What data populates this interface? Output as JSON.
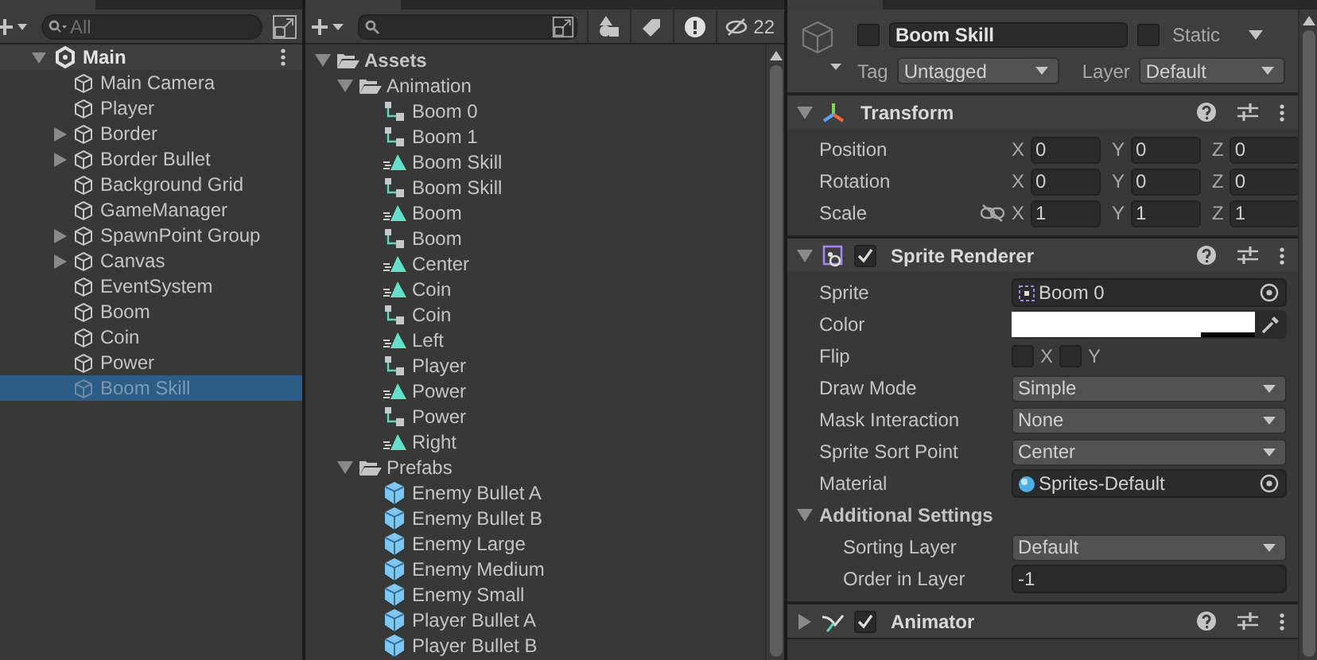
{
  "hierarchy": {
    "search": {
      "placeholder": "All"
    },
    "scene": "Main",
    "items": [
      {
        "name": "Main Camera",
        "kind": "object",
        "selected": false
      },
      {
        "name": "Player",
        "kind": "object",
        "selected": false
      },
      {
        "name": "Border",
        "kind": "group",
        "selected": false
      },
      {
        "name": "Border Bullet",
        "kind": "group",
        "selected": false
      },
      {
        "name": "Background Grid",
        "kind": "object",
        "selected": false
      },
      {
        "name": "GameManager",
        "kind": "object",
        "selected": false
      },
      {
        "name": "SpawnPoint Group",
        "kind": "group",
        "selected": false
      },
      {
        "name": "Canvas",
        "kind": "group",
        "selected": false
      },
      {
        "name": "EventSystem",
        "kind": "object",
        "selected": false
      },
      {
        "name": "Boom",
        "kind": "object",
        "selected": false
      },
      {
        "name": "Coin",
        "kind": "object",
        "selected": false
      },
      {
        "name": "Power",
        "kind": "object",
        "selected": false
      },
      {
        "name": "Boom Skill",
        "kind": "object",
        "selected": true
      }
    ]
  },
  "project": {
    "hidden_count": "22",
    "tree": [
      {
        "name": "Assets",
        "kind": "folder",
        "expanded": true,
        "children": [
          {
            "name": "Animation",
            "kind": "folder",
            "expanded": true,
            "children": [
              {
                "name": "Boom 0",
                "kind": "controller"
              },
              {
                "name": "Boom 1",
                "kind": "controller"
              },
              {
                "name": "Boom Skill",
                "kind": "clip"
              },
              {
                "name": "Boom Skill",
                "kind": "controller"
              },
              {
                "name": "Boom",
                "kind": "clip"
              },
              {
                "name": "Boom",
                "kind": "controller"
              },
              {
                "name": "Center",
                "kind": "clip"
              },
              {
                "name": "Coin",
                "kind": "clip"
              },
              {
                "name": "Coin",
                "kind": "controller"
              },
              {
                "name": "Left",
                "kind": "clip"
              },
              {
                "name": "Player",
                "kind": "controller"
              },
              {
                "name": "Power",
                "kind": "clip"
              },
              {
                "name": "Power",
                "kind": "controller"
              },
              {
                "name": "Right",
                "kind": "clip"
              }
            ]
          },
          {
            "name": "Prefabs",
            "kind": "folder",
            "expanded": true,
            "children": [
              {
                "name": "Enemy Bullet A",
                "kind": "prefab"
              },
              {
                "name": "Enemy Bullet B",
                "kind": "prefab"
              },
              {
                "name": "Enemy Large",
                "kind": "prefab"
              },
              {
                "name": "Enemy Medium",
                "kind": "prefab"
              },
              {
                "name": "Enemy Small",
                "kind": "prefab"
              },
              {
                "name": "Player Bullet A",
                "kind": "prefab"
              },
              {
                "name": "Player Bullet B",
                "kind": "prefab"
              }
            ]
          }
        ]
      }
    ]
  },
  "inspector": {
    "object_name": "Boom Skill",
    "active": false,
    "static": false,
    "static_label": "Static",
    "tag_label": "Tag",
    "tag": "Untagged",
    "layer_label": "Layer",
    "layer": "Default",
    "components": [
      {
        "name": "Transform",
        "kind": "transform",
        "expanded": true,
        "rows": [
          {
            "label": "Position",
            "kind": "vector",
            "axes": [
              "X",
              "Y",
              "Z"
            ],
            "values": [
              "0",
              "0",
              "0"
            ]
          },
          {
            "label": "Rotation",
            "kind": "vector",
            "axes": [
              "X",
              "Y",
              "Z"
            ],
            "values": [
              "0",
              "0",
              "0"
            ]
          },
          {
            "label": "Scale",
            "kind": "scale",
            "axes": [
              "X",
              "Y",
              "Z"
            ],
            "values": [
              "1",
              "1",
              "1"
            ]
          }
        ]
      },
      {
        "name": "Sprite Renderer",
        "kind": "sprite",
        "expanded": true,
        "enabled": true,
        "rows": [
          {
            "label": "Sprite",
            "kind": "sprite",
            "value": "Boom 0"
          },
          {
            "label": "Color",
            "kind": "color",
            "color": "#ffffff"
          },
          {
            "label": "Flip",
            "kind": "flip",
            "x_label": "X",
            "x": false,
            "y_label": "Y",
            "y": false
          },
          {
            "label": "Draw Mode",
            "kind": "dropdown",
            "value": "Simple"
          },
          {
            "label": "Mask Interaction",
            "kind": "dropdown",
            "value": "None"
          },
          {
            "label": "Sprite Sort Point",
            "kind": "dropdown",
            "value": "Center"
          },
          {
            "label": "Material",
            "kind": "material",
            "value": "Sprites-Default"
          },
          {
            "label": "Additional Settings",
            "kind": "section",
            "expanded": true,
            "children": [
              {
                "label": "Sorting Layer",
                "kind": "dropdown",
                "value": "Default"
              },
              {
                "label": "Order in Layer",
                "kind": "number",
                "value": "-1"
              }
            ]
          }
        ]
      },
      {
        "name": "Animator",
        "kind": "animator",
        "expanded": false,
        "enabled": true
      }
    ]
  }
}
